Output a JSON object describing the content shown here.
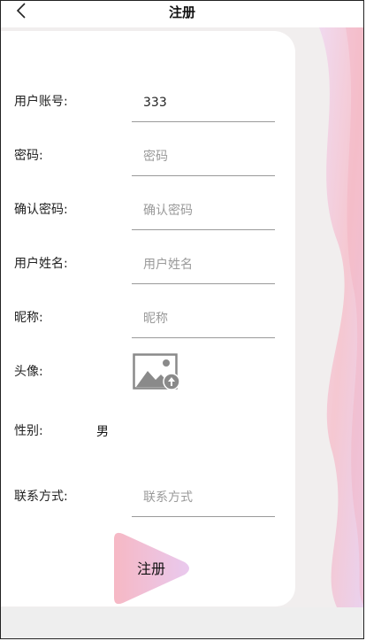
{
  "header": {
    "title": "注册"
  },
  "form": {
    "account": {
      "label": "用户账号:",
      "value": "333"
    },
    "password": {
      "label": "密码:",
      "placeholder": "密码"
    },
    "confirm": {
      "label": "确认密码:",
      "placeholder": "确认密码"
    },
    "realname": {
      "label": "用户姓名:",
      "placeholder": "用户姓名"
    },
    "nickname": {
      "label": "昵称:",
      "placeholder": "昵称"
    },
    "avatar": {
      "label": "头像:"
    },
    "gender": {
      "label": "性别:",
      "value": "男"
    },
    "contact": {
      "label": "联系方式:",
      "placeholder": "联系方式"
    }
  },
  "submit": {
    "label": "注册"
  },
  "colors": {
    "accent_pink": "#f6b8c4",
    "accent_lilac": "#e9c9ee",
    "divider": "#9a9a9a"
  },
  "icons": {
    "back": "chevron-left-icon",
    "avatar": "image-upload-icon"
  }
}
